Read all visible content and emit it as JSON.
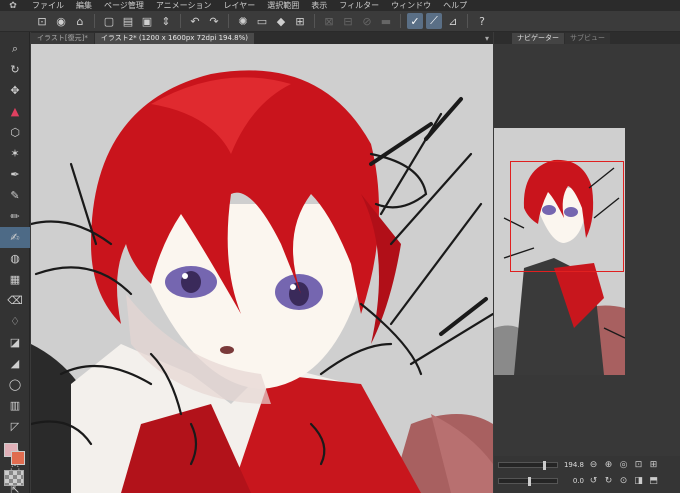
{
  "menu": {
    "logo_icon": "paw-icon",
    "items": [
      "ファイル",
      "編集",
      "ページ管理",
      "アニメーション",
      "レイヤー",
      "選択範囲",
      "表示",
      "フィルター",
      "ウィンドウ",
      "ヘルプ"
    ]
  },
  "tabs": [
    {
      "label": "イラスト[復元]*"
    },
    {
      "label": "イラスト2* (1200 x 1600px 72dpi 194.8%)"
    }
  ],
  "panel": {
    "tabs": [
      {
        "label": "ナビゲーター"
      },
      {
        "label": "サブビュー"
      }
    ]
  },
  "navigator": {
    "zoom": "194.8",
    "rotation": "0.0"
  },
  "colors": {
    "accent": "#4d6a86",
    "main_color": "#e0b0b8",
    "sub_color": "#e06c50",
    "nav_frame": "#e02020"
  }
}
